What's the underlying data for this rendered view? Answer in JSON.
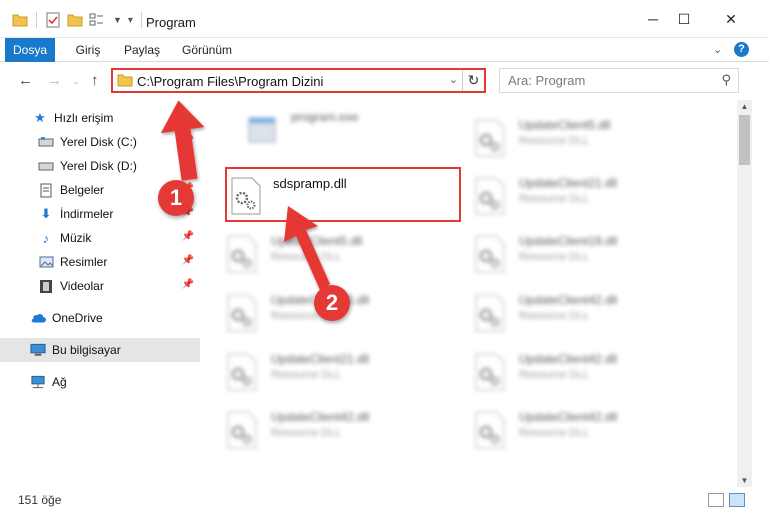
{
  "window": {
    "title": "Program",
    "minimize": "─",
    "maximize": "☐",
    "close": "✕"
  },
  "ribbon": {
    "tabs": [
      "Dosya",
      "Giriş",
      "Paylaş",
      "Görünüm"
    ]
  },
  "address": {
    "path": "C:\\Program Files\\Program Dizini",
    "search_placeholder": "Ara: Program"
  },
  "sidebar": {
    "items": [
      {
        "label": "Hızlı erişim",
        "icon": "star-icon"
      },
      {
        "label": "Yerel Disk (C:)",
        "icon": "drive-icon"
      },
      {
        "label": "Yerel Disk (D:)",
        "icon": "drive-icon"
      },
      {
        "label": "Belgeler",
        "icon": "documents-icon"
      },
      {
        "label": "İndirmeler",
        "icon": "download-icon"
      },
      {
        "label": "Müzik",
        "icon": "music-icon"
      },
      {
        "label": "Resimler",
        "icon": "pictures-icon"
      },
      {
        "label": "Videolar",
        "icon": "videos-icon"
      },
      {
        "label": "OneDrive",
        "icon": "cloud-icon"
      },
      {
        "label": "Bu bilgisayar",
        "icon": "computer-icon"
      },
      {
        "label": "Ağ",
        "icon": "network-icon"
      }
    ]
  },
  "files": {
    "left": [
      {
        "name": "program.exe",
        "type": ""
      },
      {
        "name": "sdspramp.dll",
        "type": ""
      },
      {
        "name": "UpdateClient5.dll",
        "type": "Resource DLL"
      },
      {
        "name": "UpdateClient65.dll",
        "type": "Resource DLL"
      },
      {
        "name": "UpdateClient21.dll",
        "type": "Resource DLL"
      },
      {
        "name": "UpdateClient42.dll",
        "type": "Resource DLL"
      }
    ],
    "right": [
      {
        "name": "UpdateClient5.dll",
        "type": "Resource DLL"
      },
      {
        "name": "UpdateClient21.dll",
        "type": "Resource DLL"
      },
      {
        "name": "UpdateClient19.dll",
        "type": "Resource DLL"
      },
      {
        "name": "UpdateClient42.dll",
        "type": "Resource DLL"
      },
      {
        "name": "UpdateClient42.dll",
        "type": "Resource DLL"
      },
      {
        "name": "UpdateClient42.dll",
        "type": "Resource DLL"
      }
    ]
  },
  "status": {
    "count": "151 öğe"
  },
  "annotations": {
    "step1": "1",
    "step2": "2",
    "color": "#e53935"
  }
}
